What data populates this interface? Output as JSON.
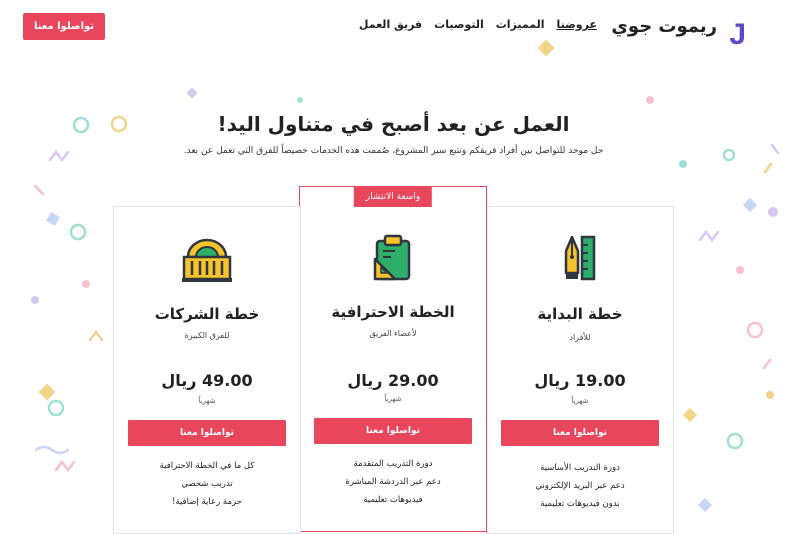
{
  "nav": {
    "logo_mark": "RJ",
    "logo_text": "ريموت جوي",
    "links": [
      {
        "label": "عروضنا",
        "active": true
      },
      {
        "label": "المميزات",
        "active": false
      },
      {
        "label": "التوصيات",
        "active": false
      },
      {
        "label": "فريق العمل",
        "active": false
      }
    ],
    "cta": "تواصلوا معنا"
  },
  "hero": {
    "title": "العمل عن بعد أصبح في متناول اليد!",
    "subtitle": "حل موحد للتواصل بين أفراد فريقكم وتتبع سير المشروع، صُممت هذه الخدمات خصيصاً للفرق التي تعمل عن بعد."
  },
  "plans": {
    "starter": {
      "icon": "pen-ruler-icon",
      "title": "خطة البداية",
      "subtitle": "للأفراد",
      "price": "19.00 ريال",
      "period": "شهرياً",
      "button": "تواصلوا معنا",
      "features": [
        "دورة التدريب الأساسية",
        "دعم عبر البريد الإلكتروني",
        "بدون فيديوهات تعليمية"
      ]
    },
    "pro": {
      "badge": "واسعة الانتشار",
      "icon": "clipboard-ruler-icon",
      "title": "الخطة الاحترافية",
      "subtitle": "لأعضاء الفريق",
      "price": "29.00 ريال",
      "period": "شهرياً",
      "button": "تواصلوا معنا",
      "features": [
        "دورة التدريب المتقدمة",
        "دعم عبر الدردشة المباشرة",
        "فيديوهات تعليمية"
      ]
    },
    "business": {
      "icon": "building-icon",
      "title": "خطة الشركات",
      "subtitle": "للفرق الكبيرة",
      "price": "49.00 ريال",
      "period": "شهرياً",
      "button": "تواصلوا معنا",
      "features": [
        "كل ما في الخطة الاحترافية",
        "تدريب شخصي",
        "حزمة رعاية إضافية!"
      ]
    }
  },
  "colors": {
    "accent": "#e8465c",
    "logo": "#5b4bc4",
    "icon_yellow": "#f5c42c",
    "icon_green": "#2fae6b",
    "icon_dark": "#2f3640"
  }
}
